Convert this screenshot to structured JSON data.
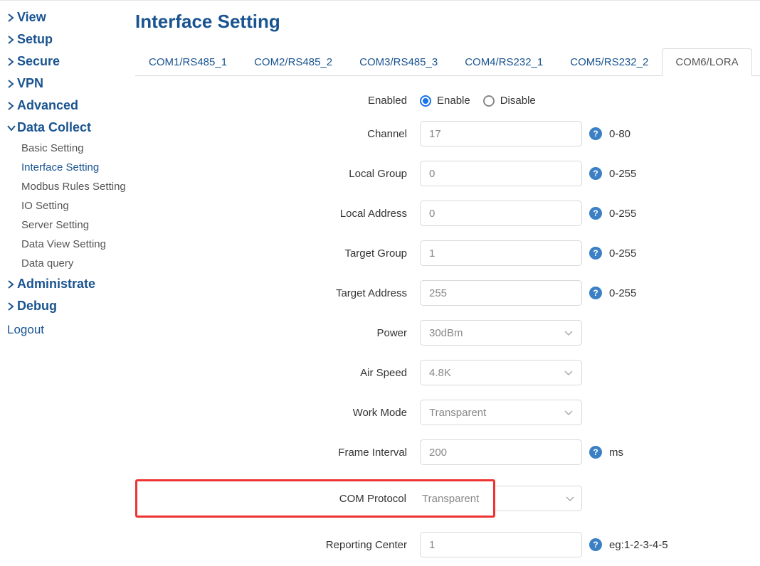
{
  "sidebar": {
    "items": [
      {
        "label": "View",
        "expanded": false
      },
      {
        "label": "Setup",
        "expanded": false
      },
      {
        "label": "Secure",
        "expanded": false
      },
      {
        "label": "VPN",
        "expanded": false
      },
      {
        "label": "Advanced",
        "expanded": false
      },
      {
        "label": "Data Collect",
        "expanded": true,
        "children": [
          {
            "label": "Basic Setting",
            "active": false
          },
          {
            "label": "Interface Setting",
            "active": true
          },
          {
            "label": "Modbus Rules Setting",
            "active": false
          },
          {
            "label": "IO Setting",
            "active": false
          },
          {
            "label": "Server Setting",
            "active": false
          },
          {
            "label": "Data View Setting",
            "active": false
          },
          {
            "label": "Data query",
            "active": false
          }
        ]
      },
      {
        "label": "Administrate",
        "expanded": false
      },
      {
        "label": "Debug",
        "expanded": false
      }
    ],
    "logout": "Logout"
  },
  "page": {
    "title": "Interface Setting",
    "tabs": [
      {
        "label": "COM1/RS485_1"
      },
      {
        "label": "COM2/RS485_2"
      },
      {
        "label": "COM3/RS485_3"
      },
      {
        "label": "COM4/RS232_1"
      },
      {
        "label": "COM5/RS232_2"
      },
      {
        "label": "COM6/LORA",
        "active": true
      }
    ]
  },
  "form": {
    "enabled": {
      "label": "Enabled",
      "opt_enable": "Enable",
      "opt_disable": "Disable",
      "value": "enable"
    },
    "channel": {
      "label": "Channel",
      "value": "17",
      "hint": "0-80"
    },
    "local_group": {
      "label": "Local Group",
      "value": "0",
      "hint": "0-255"
    },
    "local_address": {
      "label": "Local Address",
      "value": "0",
      "hint": "0-255"
    },
    "target_group": {
      "label": "Target Group",
      "value": "1",
      "hint": "0-255"
    },
    "target_address": {
      "label": "Target Address",
      "value": "255",
      "hint": "0-255"
    },
    "power": {
      "label": "Power",
      "value": "30dBm"
    },
    "air_speed": {
      "label": "Air Speed",
      "value": "4.8K"
    },
    "work_mode": {
      "label": "Work Mode",
      "value": "Transparent"
    },
    "frame_interval": {
      "label": "Frame Interval",
      "value": "200",
      "hint": "ms"
    },
    "com_protocol": {
      "label": "COM Protocol",
      "value": "Transparent"
    },
    "reporting_center": {
      "label": "Reporting Center",
      "value": "1",
      "hint": "eg:1-2-3-4-5"
    }
  }
}
